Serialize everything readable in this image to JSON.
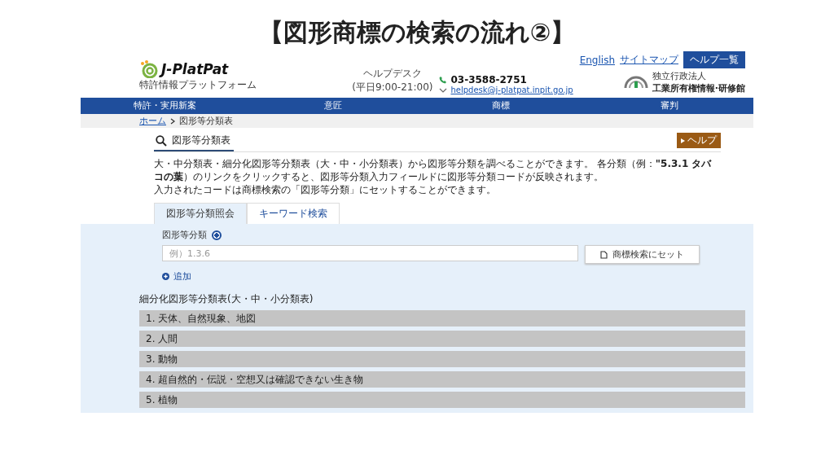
{
  "slide_title": "【図形商標の検索の流れ②】",
  "header": {
    "logo_name": "J-PlatPat",
    "logo_sub": "特許情報プラットフォーム",
    "helpdesk_label": "ヘルプデスク",
    "helpdesk_hours": "(平日9:00-21:00)",
    "phone": "03-3588-2751",
    "email": "helpdesk@j-platpat.inpit.go.jp",
    "links": [
      "English",
      "サイトマップ"
    ],
    "help_button": "ヘルプ一覧",
    "org_sub": "独立行政法人",
    "org_name": "工業所有権情報·研修館"
  },
  "nav": [
    "特許・実用新案",
    "意匠",
    "商標",
    "審判"
  ],
  "breadcrumb": [
    "ホーム",
    "図形等分類表"
  ],
  "page_title": "図形等分類表",
  "help_badge": "ヘルプ",
  "description": [
    "大・中分類表・細分化図形等分類表（大・中・小分類表）から図形等分類を調べることができます。 各分類（例：**\"5.3.1 タバコの葉**）のリンクをクリックすると、図形等分類入力フィールドに図形等分類コードが反映されます。",
    "入力されたコードは商標検索の「図形等分類」にセットすることができます。"
  ],
  "tabs": [
    {
      "label": "図形等分類照会",
      "selected": true
    },
    {
      "label": "キーワード検索",
      "selected": false
    }
  ],
  "form": {
    "label": "図形等分類",
    "checked": true,
    "placeholder": "例）1.3.6",
    "set_button": "商標検索にセット",
    "add_link": "追加"
  },
  "list_title": "細分化図形等分類表(大・中・小分類表)",
  "categories": [
    "1. 天体、自然現象、地図",
    "2. 人間",
    "3. 動物",
    "4. 超自然的・伝説・空想又は確認できない生き物",
    "5. 植物"
  ]
}
